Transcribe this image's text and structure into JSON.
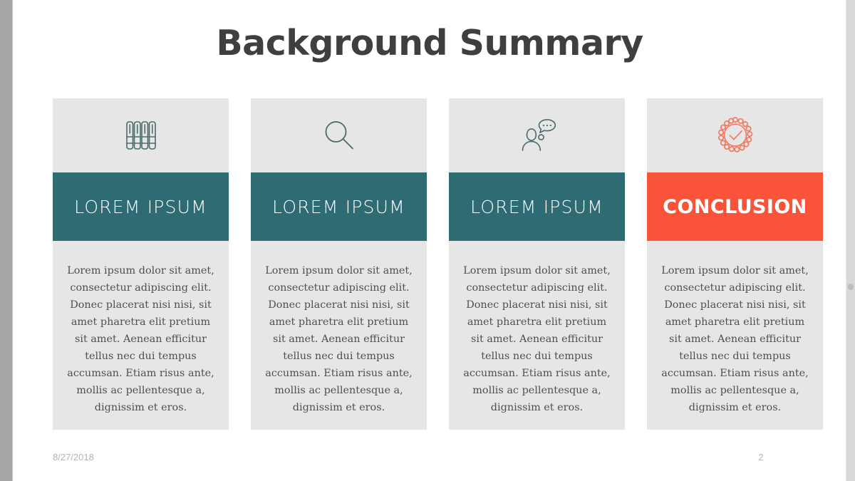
{
  "slide": {
    "title": "Background Summary",
    "background_color": "#FFFFFF"
  },
  "theme": {
    "title_color": "#3F3F3F",
    "banner_teal": "#2E6B73",
    "banner_accent": "#F9543A",
    "card_background": "#E6E6E6",
    "body_text_color": "#4F4F4F",
    "footer_text_color": "#B3B3B3",
    "icon_stroke_teal": "#4A6B6B",
    "icon_stroke_accent": "#F07A63"
  },
  "cards": [
    {
      "icon": "books-icon",
      "banner_label": "LOREM IPSUM",
      "banner_color": "#2E6B73",
      "body": "Lorem ipsum dolor sit amet, consectetur adipiscing elit. Donec placerat nisi nisi, sit amet pharetra elit pretium sit amet. Aenean efficitur tellus nec dui tempus accumsan. Etiam risus ante, mollis ac pellentesque a, dignissim et eros."
    },
    {
      "icon": "magnifier-icon",
      "banner_label": "LOREM IPSUM",
      "banner_color": "#2E6B73",
      "body": "Lorem ipsum dolor sit amet, consectetur adipiscing elit. Donec placerat nisi nisi, sit amet pharetra elit pretium sit amet. Aenean efficitur tellus nec dui tempus accumsan. Etiam risus ante, mollis ac pellentesque a, dignissim et eros."
    },
    {
      "icon": "person-speech-bubble-icon",
      "banner_label": "LOREM IPSUM",
      "banner_color": "#2E6B73",
      "body": "Lorem ipsum dolor sit amet, consectetur adipiscing elit. Donec placerat nisi nisi, sit amet pharetra elit pretium sit amet. Aenean efficitur tellus nec dui tempus accumsan. Etiam risus ante, mollis ac pellentesque a, dignissim et eros."
    },
    {
      "icon": "check-badge-icon",
      "banner_label": "CONCLUSION",
      "banner_color": "#F9543A",
      "body": "Lorem ipsum dolor sit amet, consectetur adipiscing elit. Donec placerat nisi nisi, sit amet pharetra elit pretium sit amet. Aenean efficitur tellus nec dui tempus accumsan. Etiam risus ante, mollis ac pellentesque a, dignissim et eros."
    }
  ],
  "footer": {
    "date": "8/27/2018",
    "page_number": "2"
  }
}
